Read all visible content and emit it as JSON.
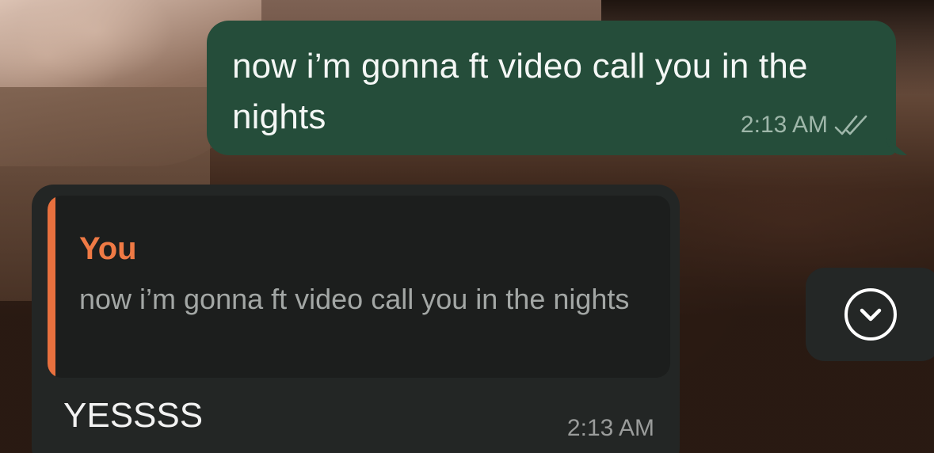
{
  "conversation": {
    "outgoing": {
      "text": "now i’m gonna ft video call you in the nights",
      "time": "2:13 AM",
      "status_icon": "double-check-read-icon"
    },
    "incoming": {
      "reply": {
        "author": "You",
        "text": "now i’m gonna ft video call you in the nights"
      },
      "text": "YESSSS",
      "time": "2:13 AM"
    }
  },
  "controls": {
    "scroll_down_icon": "chevron-down-circle-icon"
  },
  "colors": {
    "outgoing_bubble": "#254d3a",
    "incoming_bubble": "#232625",
    "reply_accent": "#e8703e",
    "reply_author": "#ef7a45"
  }
}
